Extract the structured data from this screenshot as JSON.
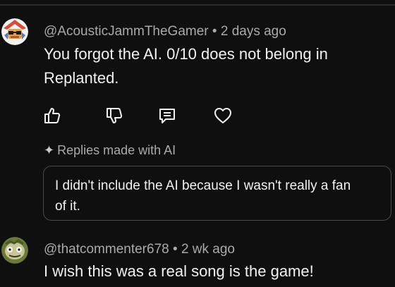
{
  "comments": [
    {
      "author": "@AcousticJammTheGamer",
      "separator": "•",
      "time": "2 days ago",
      "text_line1": "You forgot the AI. 0/10 does not belong in",
      "text_line2": "Replanted.",
      "avatar_icon": "gamer-avatar-icon"
    },
    {
      "author": "@thatcommenter678",
      "separator": "•",
      "time": "2 wk ago",
      "text": "I wish this was a real song is the game!",
      "avatar_icon": "zombie-avatar-icon"
    }
  ],
  "actions": [
    "thumbs-up-icon",
    "thumbs-down-icon",
    "reply-icon",
    "heart-icon"
  ],
  "ai_replies": {
    "spark": "✦",
    "label": "Replies made with AI",
    "reply_line1": "I didn't include the AI because I wasn't really a fan",
    "reply_line2": "of it."
  },
  "colors": {
    "background": "#0f0f0f",
    "text": "#f1f1f1",
    "meta": "#aaaaaa"
  }
}
